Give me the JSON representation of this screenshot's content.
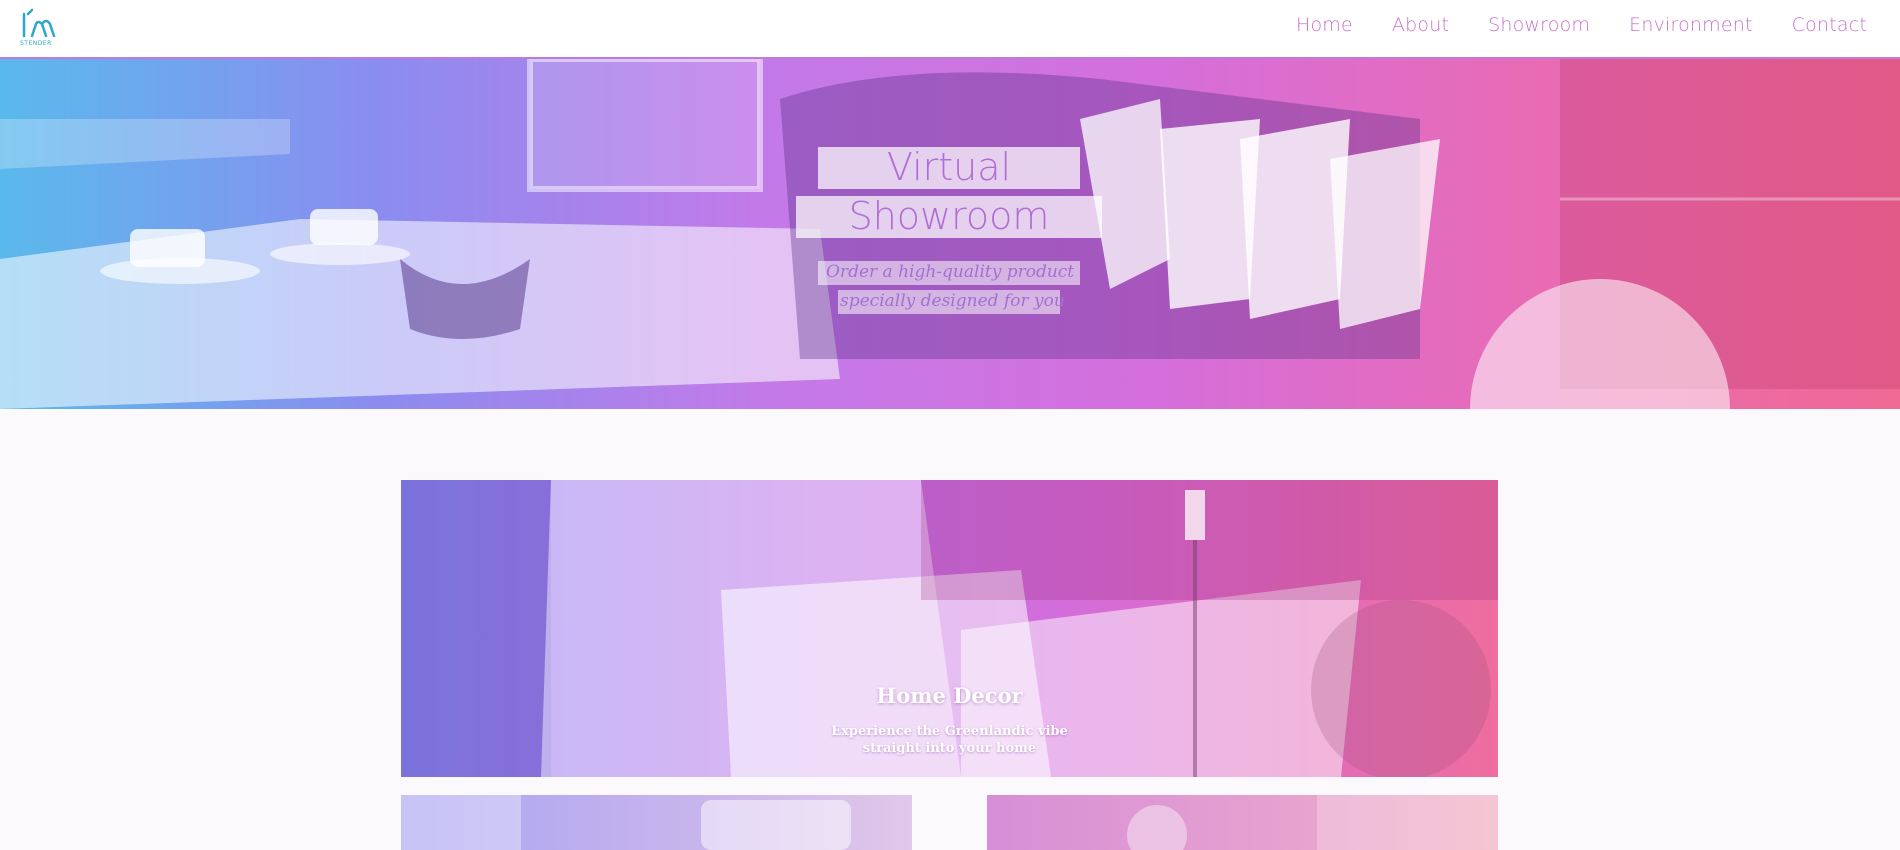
{
  "brand": {
    "logo_text": "STENDER"
  },
  "nav": {
    "items": [
      {
        "label": "Home"
      },
      {
        "label": "About"
      },
      {
        "label": "Showroom"
      },
      {
        "label": "Environment"
      },
      {
        "label": "Contact"
      }
    ]
  },
  "hero": {
    "title_line1": "Virtual",
    "title_line2": "Showroom",
    "subtitle_line1": "Order a high-quality product",
    "subtitle_line2": "specially designed for you"
  },
  "cards": {
    "main": {
      "title": "Home Decor",
      "desc_line1": "Experience the Greenlandic vibe",
      "desc_line2": "straight into your home"
    }
  },
  "colors": {
    "accent": "#c873c9",
    "logo": "#2aa8c8"
  }
}
